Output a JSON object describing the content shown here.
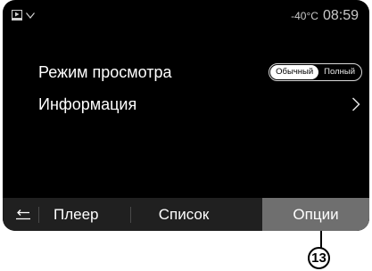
{
  "status": {
    "temperature": "-40°C",
    "time": "08:59"
  },
  "settings": {
    "view_mode": {
      "label": "Режим просмотра",
      "options": [
        "Обычный",
        "Полный"
      ],
      "selected": "Обычный"
    },
    "info": {
      "label": "Информация"
    }
  },
  "bottom_bar": {
    "tabs": [
      "Плеер",
      "Список",
      "Опции"
    ],
    "active": "Опции"
  },
  "callout": {
    "number": "13"
  }
}
